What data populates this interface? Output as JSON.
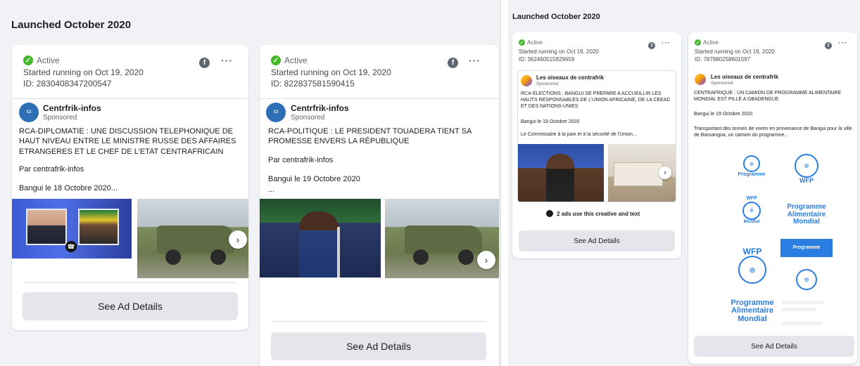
{
  "left_panel": {
    "section_title": "Launched October 2020",
    "cards": [
      {
        "status": "Active",
        "started": "Started running on Oct 19, 2020",
        "id": "ID: 2830408347200547",
        "page_name": "Centrfrik-infos",
        "sponsored": "Sponsored",
        "body": "RCA-DIPLOMATIE : UNE DISCUSSION TELEPHONIQUE DE HAUT NIVEAU ENTRE LE MINISTRE RUSSE DES AFFAIRES ETRANGERES ET LE CHEF DE L'ETAT CENTRAFRICAIN",
        "line2": "Par centrafrik-infos",
        "line3": "Bangui le 18 Octobre 2020...",
        "details_button": "See Ad Details"
      },
      {
        "status": "Active",
        "started": "Started running on Oct 19, 2020",
        "id": "ID: 822837581590415",
        "page_name": "Centrfrik-infos",
        "sponsored": "Sponsored",
        "body": "RCA-POLITIQUE : LE PRESIDENT TOUADERA TIENT SA PROMESSE ENVERS LA RÉPUBLIQUE",
        "line2": "Par centrafrik-infos",
        "line3": "Bangui le 19 Octobre 2020",
        "line4": "...",
        "details_button": "See Ad Details"
      }
    ]
  },
  "right_panel": {
    "section_title": "Launched October 2020",
    "cards": [
      {
        "status": "Active",
        "started": "Started running on Oct 19, 2020",
        "id": "ID: 362460515829659",
        "page_name": "Les oiseaux de centrafrik",
        "sponsored": "Sponsored",
        "body": "RCA-ELECTIONS : BANGUI SE PREPARE A ACCUEILLIR LES HAUTS RESPONSABLES DE L'UNION AFRICAINE, DE LA CEEAC ET DES NATIONS-UNIES",
        "line2": "Bangui le 19 Octobre 2020",
        "line3": "Le Commissaire à la paix et à la sécurité de l'Union...",
        "shared_note": "2 ads use this creative and text",
        "details_button": "See Ad Details"
      },
      {
        "status": "Active",
        "started": "Started running on Oct 19, 2020",
        "id": "ID: 787980258601597",
        "page_name": "Les oiseaux de centrafrik",
        "sponsored": "Sponsored",
        "body": "CENTRAFRIQUE : UN CAMION DE PROGRAMME ALIMENTAIRE MONDIAL EST PILLÉ A GBADENGUE",
        "line2": "Bangui le 19 Octobre 2020",
        "line3": "Transportant des tonnes de vivres en provenance de Bangui pour la ville de Bassangoa, un camion du programme...",
        "details_button": "See Ad Details",
        "wfp_labels": {
          "wfp": "WFP",
          "programme": "Programme",
          "alimentaire": "Alimentaire",
          "mondial": "Mondial"
        }
      }
    ]
  },
  "icons": {
    "status": "check-circle-icon",
    "platform": "facebook-icon",
    "menu": "more-horizontal-icon",
    "carousel": "chevron-right-icon"
  },
  "colors": {
    "active_green": "#42b72a",
    "button_gray": "#e4e6eb",
    "wfp_blue": "#2a7de1"
  }
}
